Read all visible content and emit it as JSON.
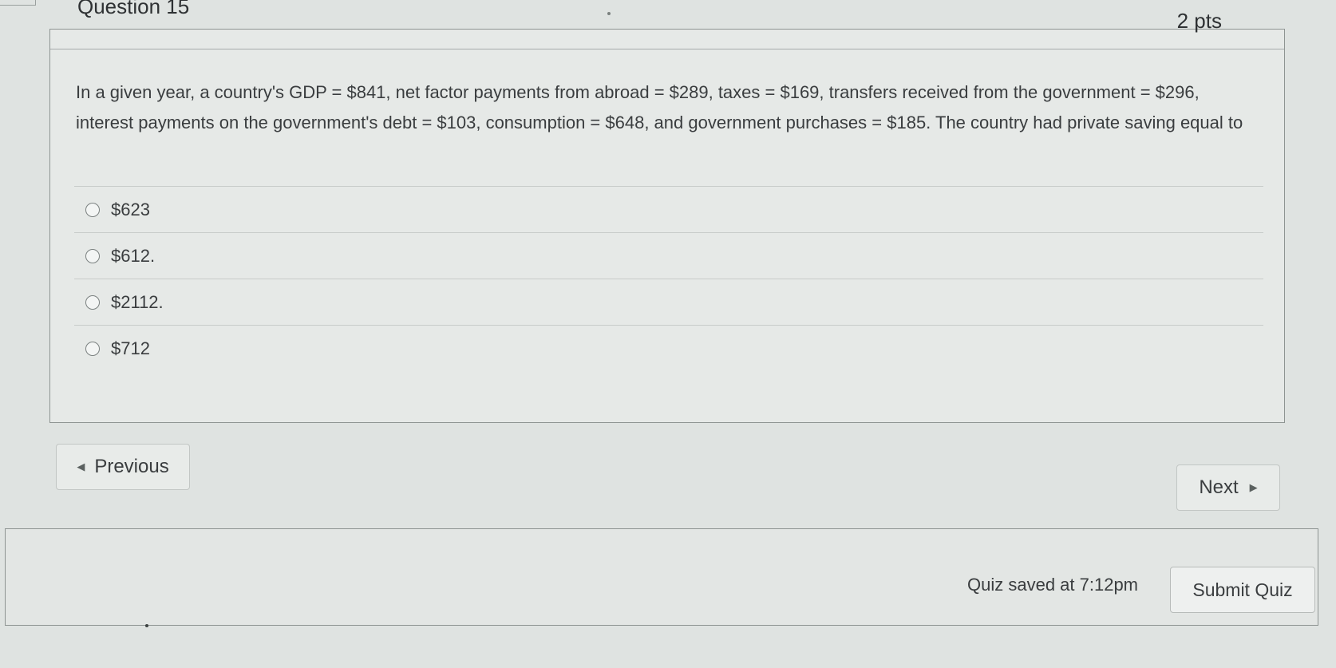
{
  "question": {
    "title": "Question 15",
    "points": "2 pts",
    "text": "In a given year, a country's GDP = $841, net factor payments from abroad = $289, taxes = $169, transfers received from the government = $296, interest payments on the government's debt = $103, consumption = $648, and government purchases = $185. The country had private saving equal to",
    "answers": [
      {
        "label": "$623"
      },
      {
        "label": "$612."
      },
      {
        "label": "$2112."
      },
      {
        "label": "$712"
      }
    ]
  },
  "navigation": {
    "previous_label": "Previous",
    "next_label": "Next",
    "previous_icon": "caret-left-icon",
    "next_icon": "caret-right-icon"
  },
  "footer": {
    "saved_status": "Quiz saved at 7:12pm",
    "submit_label": "Submit Quiz"
  },
  "colors": {
    "background": "#dfe3e1",
    "card": "#e6e9e7",
    "text": "#3a3d3f",
    "border": "#8e9492"
  }
}
